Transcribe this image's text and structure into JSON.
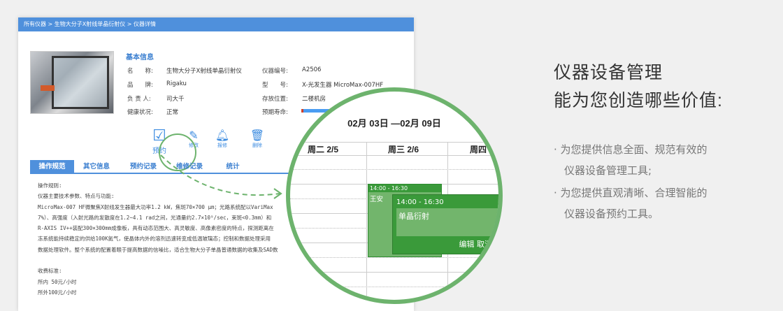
{
  "breadcrumb": "所有仪器 > 生物大分子X射线单晶衍射仪 > 仪器详情",
  "basic": {
    "title": "基本信息",
    "fields": [
      {
        "label": "名　　称:",
        "value": "生物大分子X射线单晶衍射仪"
      },
      {
        "label": "品　　牌:",
        "value": "Rigaku"
      },
      {
        "label": "负 责 人:",
        "value": "司大千"
      },
      {
        "label": "健康状况:",
        "value": "正常"
      },
      {
        "label": "仪器编号:",
        "value": "A2506"
      },
      {
        "label": "型　　号:",
        "value": "X-光发生器 MicroMax-007HF"
      },
      {
        "label": "存放位置:",
        "value": "二楼机房"
      },
      {
        "label": "预期寿命:",
        "value": ""
      }
    ]
  },
  "actions": {
    "reserve": "预约",
    "edit": "修改",
    "report": "报修",
    "delete": "删除"
  },
  "tabs": [
    "操作规范",
    "其它信息",
    "预约记录",
    "维修记录",
    "统计"
  ],
  "content": [
    "操作规则:",
    "仪器主要技术参数、特点与功能:",
    "MicroMax-007 HF微聚焦X射线发生器最大功率1.2 kW，焦斑70×700 μm；光路系统配以VariMax",
    "7%）、高强度（入射光路的发散度在1.2~4.1 rad之间，光通量约2.7×10⁹/sec，束斑<0.3mm）和",
    "R-AXIS IV++装配300×300mm成像板，具有动态范围大、高灵敏度、高像素密度的特点，探测距离在",
    "冻系统能持续稳定的供给100K氮气，使晶体内外的溶剂迅速转变成低温玻璃态；控制和数据处理采用",
    "数据处理软件。整个系统的配置着眼于提高数据的信噪比，适合生物大分子单晶普通数据的收集及SAD数",
    "",
    "收费标准:",
    "所内 50元/小时",
    "所外100元/小时"
  ],
  "calendar": {
    "range": "02月 03日 —02月 09日",
    "days": [
      "周二 2/5",
      "周三 2/6",
      "周四"
    ],
    "event1": {
      "time": "14:00 - 16:30",
      "name": "王安"
    },
    "event2": {
      "time": "14:00 - 16:30",
      "name": "单晶衍射",
      "edit": "编辑",
      "cancel": "取消"
    }
  },
  "promo": {
    "title1": "仪器设备管理",
    "title2": "能为您创造哪些价值:",
    "bullets": [
      "· 为您提供信息全面、规范有效的",
      "　仪器设备管理工具;",
      "· 为您提供直观清晰、合理智能的",
      "　仪器设备预约工具。"
    ]
  },
  "colors": {
    "primary": "#4f90dc",
    "accent_green": "#6db36d",
    "event_green": "#3a9a3a"
  }
}
